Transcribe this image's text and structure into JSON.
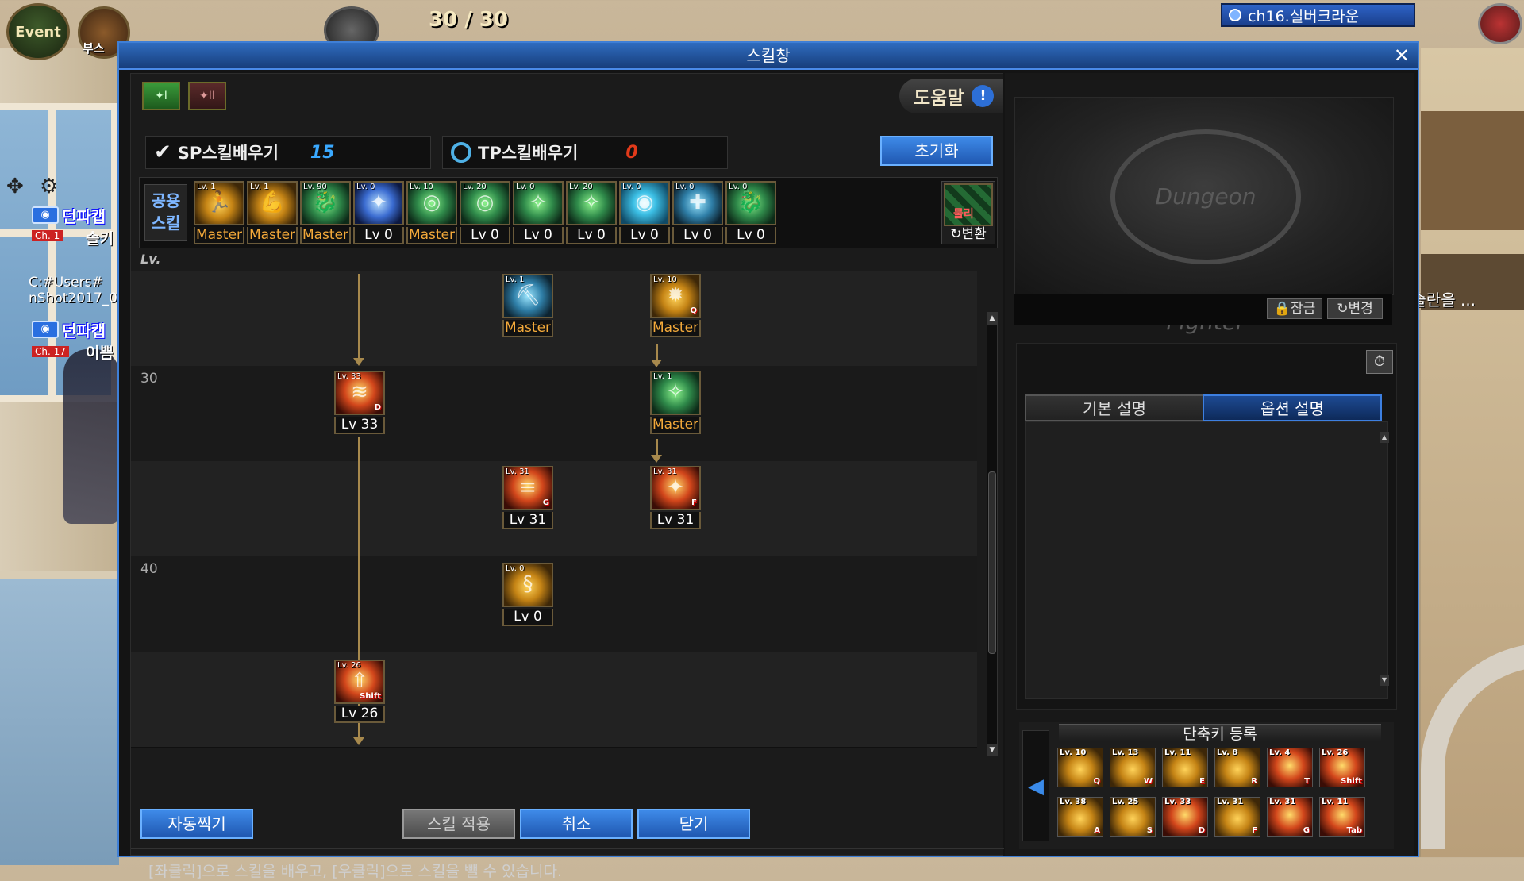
{
  "hud": {
    "event_label": "Event",
    "boost_label": "부스",
    "fatigue": "30 / 30",
    "channel": "ch16.실버크라운"
  },
  "world": {
    "party": [
      {
        "name": "던파캡",
        "channel": "Ch. 1",
        "sub": "솔키"
      },
      {
        "name": "던파캡",
        "channel": "Ch. 17",
        "sub": "이쁨"
      }
    ],
    "path_text": [
      "C:#Users#",
      "nShot2017_0"
    ],
    "right_text": "이슬란을 ..."
  },
  "window": {
    "title": "스킬창",
    "tree_tabs": [
      "I",
      "II"
    ],
    "help_label": "도움말",
    "sp": {
      "label": "SP스킬배우기",
      "value": "15"
    },
    "tp": {
      "label": "TP스킬배우기",
      "value": "0"
    },
    "reset_label": "초기화",
    "common_label": [
      "공용",
      "스킬"
    ],
    "lv_header": "Lv.",
    "swap": {
      "top_label": "물리",
      "caption": "변환"
    },
    "common_skills": [
      {
        "tag": "Lv. 1",
        "caption": "Master",
        "kind": "master",
        "color": "gold",
        "glyph": "🏃"
      },
      {
        "tag": "Lv. 1",
        "caption": "Master",
        "kind": "master",
        "color": "gold",
        "glyph": "💪"
      },
      {
        "tag": "Lv. 90",
        "caption": "Master",
        "kind": "master",
        "color": "green",
        "glyph": "🐉"
      },
      {
        "tag": "Lv. 0",
        "caption": "Lv 0",
        "kind": "lv",
        "color": "blue",
        "glyph": "✦"
      },
      {
        "tag": "Lv. 10",
        "caption": "Master",
        "kind": "master",
        "color": "green",
        "glyph": "◎"
      },
      {
        "tag": "Lv. 20",
        "caption": "Lv 0",
        "kind": "lv",
        "color": "green",
        "glyph": "◎"
      },
      {
        "tag": "Lv. 0",
        "caption": "Lv 0",
        "kind": "lv",
        "color": "green",
        "glyph": "✧"
      },
      {
        "tag": "Lv. 20",
        "caption": "Lv 0",
        "kind": "lv",
        "color": "green",
        "glyph": "✧"
      },
      {
        "tag": "Lv. 0",
        "caption": "Lv 0",
        "kind": "lv",
        "color": "cyan",
        "glyph": "◉"
      },
      {
        "tag": "Lv. 0",
        "caption": "Lv 0",
        "kind": "lv",
        "color": "teal",
        "glyph": "✚"
      },
      {
        "tag": "Lv. 0",
        "caption": "Lv 0",
        "kind": "lv",
        "color": "green",
        "glyph": "🐉"
      }
    ],
    "row_levels": [
      "30",
      "40"
    ],
    "tree_skills": [
      {
        "tag": "Lv. 1",
        "caption": "Master",
        "kind": "master",
        "color": "teal",
        "hotkey": "",
        "glyph": "⛏"
      },
      {
        "tag": "Lv. 10",
        "caption": "Master",
        "kind": "master",
        "color": "gold",
        "hotkey": "Q",
        "glyph": "✹"
      },
      {
        "tag": "Lv. 33",
        "caption": "Lv 33",
        "kind": "lv",
        "color": "red",
        "hotkey": "D",
        "glyph": "≋"
      },
      {
        "tag": "Lv. 1",
        "caption": "Master",
        "kind": "master",
        "color": "green",
        "hotkey": "",
        "glyph": "✧"
      },
      {
        "tag": "Lv. 31",
        "caption": "Lv 31",
        "kind": "lv",
        "color": "red",
        "hotkey": "G",
        "glyph": "≡"
      },
      {
        "tag": "Lv. 31",
        "caption": "Lv 31",
        "kind": "lv",
        "color": "red",
        "hotkey": "F",
        "glyph": "✦"
      },
      {
        "tag": "Lv. 0",
        "caption": "Lv 0",
        "kind": "lv",
        "color": "gold",
        "hotkey": "",
        "glyph": "§"
      },
      {
        "tag": "Lv. 26",
        "caption": "Lv 26",
        "kind": "lv",
        "color": "red",
        "hotkey": "Shift",
        "glyph": "⇧"
      }
    ],
    "buttons": {
      "auto": "자동찍기",
      "apply": "스킬 적용",
      "cancel": "취소",
      "close": "닫기"
    },
    "hint": "[좌클릭]으로 스킬을 배우고, [우클릭]으로 스킬을 뺄 수 있습니다.",
    "preview": {
      "lock_label": "잠금",
      "change_label": "변경",
      "emblem": "Dungeon Fighter"
    },
    "desc_tabs": {
      "basic": "기본 설명",
      "option": "옵션 설명"
    },
    "hotkey_title": "단축키 등록",
    "hotkeys": [
      {
        "tag": "Lv. 10",
        "key": "Q"
      },
      {
        "tag": "Lv. 13",
        "key": "W"
      },
      {
        "tag": "Lv. 11",
        "key": "E"
      },
      {
        "tag": "Lv. 8",
        "key": "R"
      },
      {
        "tag": "Lv. 4",
        "key": "T"
      },
      {
        "tag": "Lv. 26",
        "key": "Shift"
      },
      {
        "tag": "Lv. 38",
        "key": "A"
      },
      {
        "tag": "Lv. 25",
        "key": "S"
      },
      {
        "tag": "Lv. 33",
        "key": "D"
      },
      {
        "tag": "Lv. 31",
        "key": "F"
      },
      {
        "tag": "Lv. 31",
        "key": "G"
      },
      {
        "tag": "Lv. 11",
        "key": "Tab"
      }
    ]
  }
}
